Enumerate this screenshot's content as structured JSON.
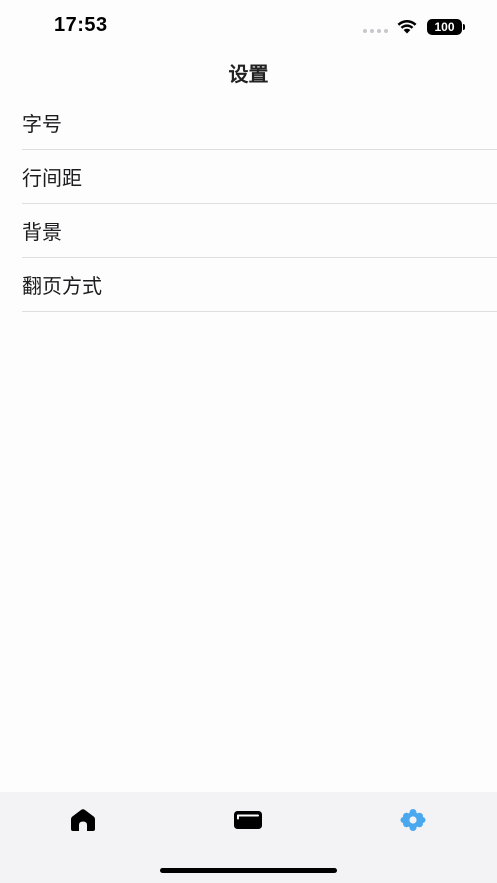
{
  "status_bar": {
    "time": "17:53",
    "battery": "100"
  },
  "nav": {
    "title": "设置"
  },
  "settings": {
    "items": [
      {
        "label": "字号"
      },
      {
        "label": "行间距"
      },
      {
        "label": "背景"
      },
      {
        "label": "翻页方式"
      }
    ]
  },
  "tab_bar": {
    "tabs": [
      {
        "icon": "home-icon",
        "selected": false
      },
      {
        "icon": "book-icon",
        "selected": false
      },
      {
        "icon": "gear-icon",
        "selected": true
      }
    ],
    "selected_color": "#4aa8ef",
    "unselected_color": "#000000"
  }
}
